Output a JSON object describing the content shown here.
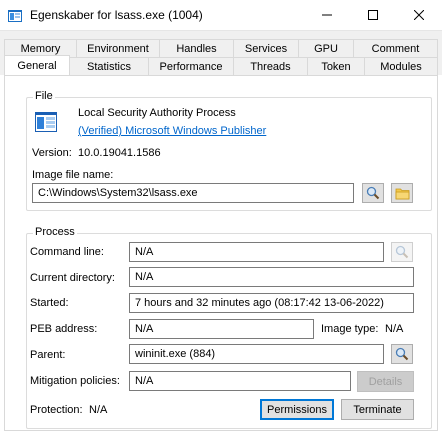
{
  "window": {
    "title": "Egenskaber for lsass.exe (1004)"
  },
  "tabs": {
    "row1": [
      "Memory",
      "Environment",
      "Handles",
      "Services",
      "GPU",
      "Comment"
    ],
    "row2": [
      "General",
      "Statistics",
      "Performance",
      "Threads",
      "Token",
      "Modules"
    ],
    "active": "General"
  },
  "file": {
    "legend": "File",
    "description": "Local Security Authority Process",
    "publisher": "(Verified) Microsoft Windows Publisher",
    "version_label": "Version:",
    "version_value": "10.0.19041.1586",
    "image_label": "Image file name:",
    "image_value": "C:\\Windows\\System32\\lsass.exe"
  },
  "process": {
    "legend": "Process",
    "command_line_label": "Command line:",
    "command_line_value": "N/A",
    "current_dir_label": "Current directory:",
    "current_dir_value": "N/A",
    "started_label": "Started:",
    "started_value": "7 hours and 32 minutes ago (08:17:42 13-06-2022)",
    "peb_label": "PEB address:",
    "peb_value": "N/A",
    "image_type_label": "Image type:",
    "image_type_value": "N/A",
    "parent_label": "Parent:",
    "parent_value": "wininit.exe (884)",
    "mitigation_label": "Mitigation policies:",
    "mitigation_value": "N/A",
    "details_button": "Details",
    "protection_label": "Protection:",
    "protection_value": "N/A",
    "permissions_button": "Permissions",
    "terminate_button": "Terminate"
  },
  "icons": {
    "app": "process-hacker-icon",
    "minimize": "minimize-icon",
    "maximize": "maximize-icon",
    "close": "close-icon",
    "file_image": "application-window-icon",
    "search": "magnifier-icon",
    "folder": "folder-icon"
  },
  "colors": {
    "link": "#0066cc",
    "accent": "#0078d7"
  }
}
